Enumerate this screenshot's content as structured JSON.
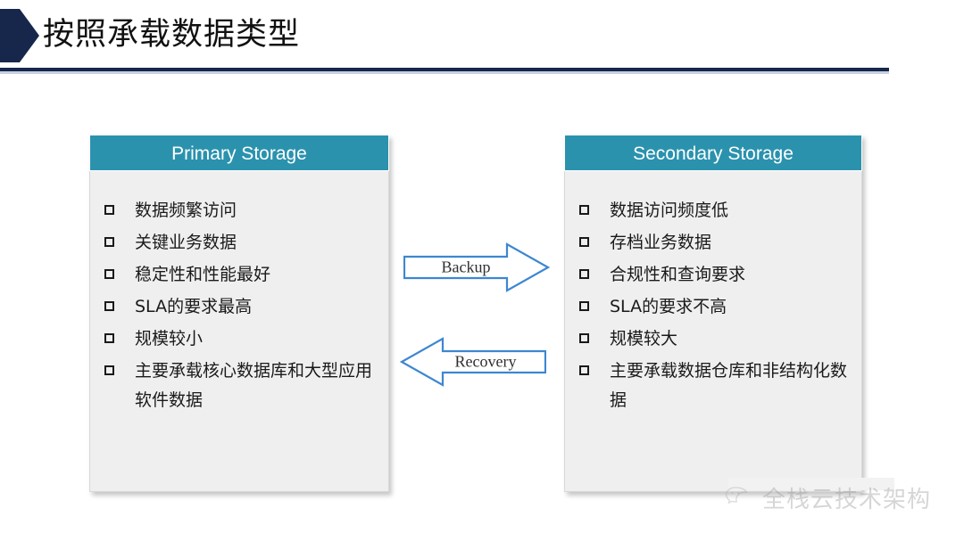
{
  "slide": {
    "title": "按照承载数据类型",
    "accent_navy": "#16274b",
    "accent_teal": "#2b92ae",
    "accent_blue": "#3d87d0",
    "body_bg": "#efefef"
  },
  "icons": {
    "title_chevron": "chevron-right-solid-icon",
    "bullet": "hollow-square-bullet-icon",
    "wechat": "wechat-logo-icon"
  },
  "cards": [
    {
      "id": "primary",
      "header": "Primary Storage",
      "items": [
        "数据频繁访问",
        "关键业务数据",
        "稳定性和性能最好",
        "SLA的要求最高",
        "规模较小",
        "主要承载核心数据库和大型应用软件数据"
      ]
    },
    {
      "id": "secondary",
      "header": "Secondary Storage",
      "items": [
        "数据访问频度低",
        "存档业务数据",
        "合规性和查询要求",
        "SLA的要求不高",
        "规模较大",
        "主要承载数据仓库和非结构化数据"
      ]
    }
  ],
  "arrows": [
    {
      "id": "backup",
      "label": "Backup",
      "direction": "right",
      "color": "#3d87d0"
    },
    {
      "id": "recovery",
      "label": "Recovery",
      "direction": "left",
      "color": "#3d87d0"
    }
  ],
  "watermark": {
    "text": "全栈云技术架构"
  }
}
